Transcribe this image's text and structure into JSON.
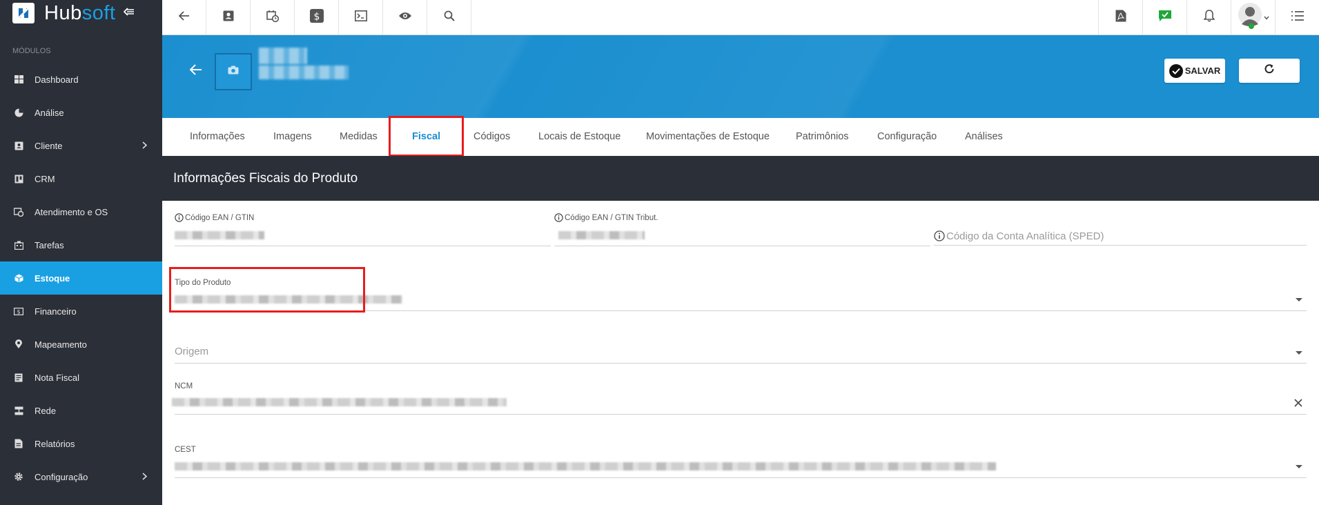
{
  "app": {
    "logo_hub": "Hub",
    "logo_soft": "soft"
  },
  "sidebar": {
    "section_label": "MÓDULOS",
    "items": [
      {
        "label": "Dashboard",
        "icon": "dashboard-icon"
      },
      {
        "label": "Análise",
        "icon": "pie-chart-icon"
      },
      {
        "label": "Cliente",
        "icon": "contact-card-icon"
      },
      {
        "label": "CRM",
        "icon": "crm-icon"
      },
      {
        "label": "Atendimento e OS",
        "icon": "calendar-clock-icon"
      },
      {
        "label": "Tarefas",
        "icon": "tasks-icon"
      },
      {
        "label": "Estoque",
        "icon": "box-icon"
      },
      {
        "label": "Financeiro",
        "icon": "money-icon"
      },
      {
        "label": "Mapeamento",
        "icon": "map-pin-icon"
      },
      {
        "label": "Nota Fiscal",
        "icon": "invoice-icon"
      },
      {
        "label": "Rede",
        "icon": "network-icon"
      },
      {
        "label": "Relatórios",
        "icon": "report-icon"
      },
      {
        "label": "Configuração",
        "icon": "gear-icon"
      }
    ]
  },
  "header": {
    "save_label": "SALVAR"
  },
  "tabs": [
    {
      "label": "Informações"
    },
    {
      "label": "Imagens"
    },
    {
      "label": "Medidas"
    },
    {
      "label": "Fiscal"
    },
    {
      "label": "Códigos"
    },
    {
      "label": "Locais de Estoque"
    },
    {
      "label": "Movimentações de Estoque"
    },
    {
      "label": "Patrimônios"
    },
    {
      "label": "Configuração"
    },
    {
      "label": "Análises"
    }
  ],
  "section": {
    "title": "Informações Fiscais do Produto"
  },
  "form": {
    "ean_label": "Código EAN / GTIN",
    "ean_trib_label": "Código EAN / GTIN Tribut.",
    "conta_analitica_placeholder": "Código da Conta Analítica (SPED)",
    "tipo_produto_label": "Tipo do Produto",
    "origem_placeholder": "Origem",
    "ncm_label": "NCM",
    "cest_label": "CEST"
  },
  "colors": {
    "accent": "#1b8fd0",
    "sidebar_bg": "#2b2f38",
    "active_item": "#19a0e3",
    "highlight": "#e81c1c"
  }
}
